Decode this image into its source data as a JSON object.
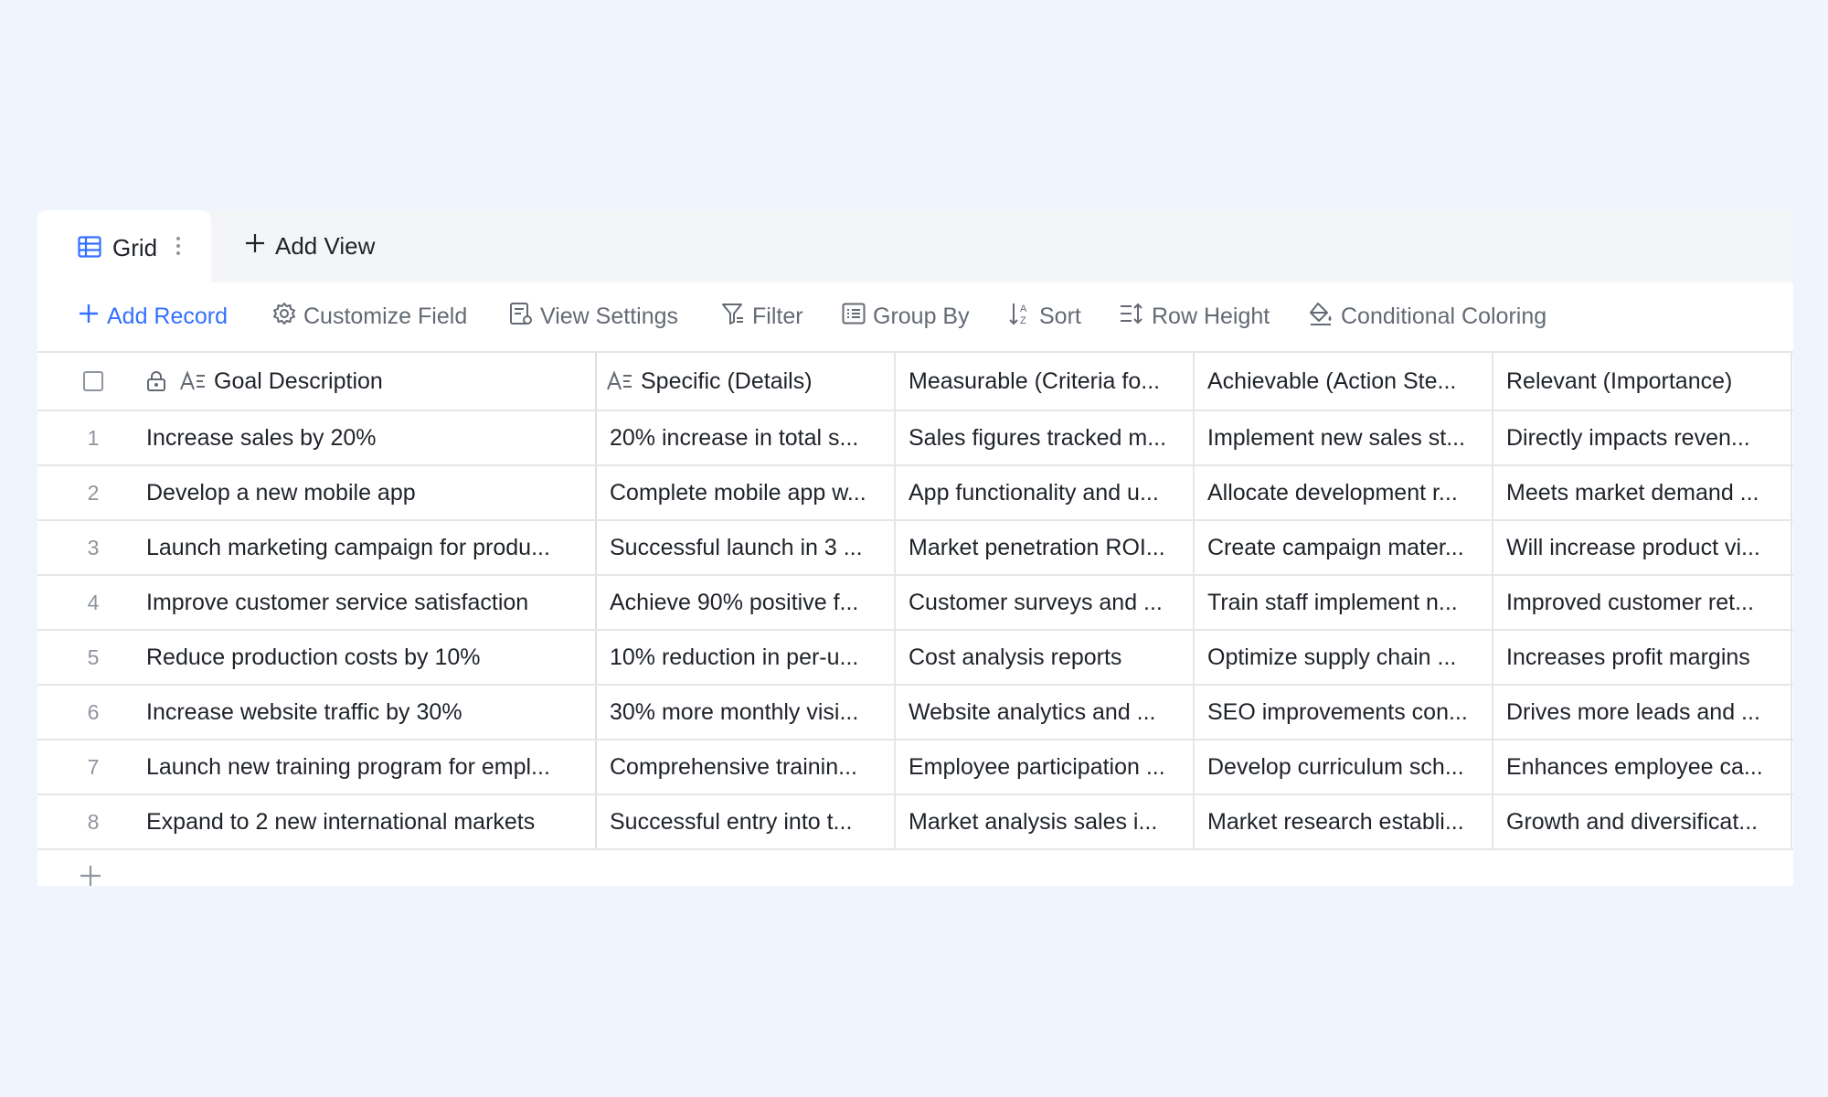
{
  "tabs": {
    "active_label": "Grid",
    "add_view_label": "Add View"
  },
  "toolbar": {
    "add_record": "Add Record",
    "customize_field": "Customize Field",
    "view_settings": "View Settings",
    "filter": "Filter",
    "group_by": "Group By",
    "sort": "Sort",
    "row_height": "Row Height",
    "conditional_coloring": "Conditional Coloring"
  },
  "table": {
    "columns": {
      "goal": "Goal Description",
      "specific": "Specific (Details)",
      "measurable": "Measurable (Criteria fo...",
      "achievable": "Achievable (Action Ste...",
      "relevant": "Relevant (Importance)"
    },
    "rows": [
      {
        "num": "1",
        "goal": "Increase sales by 20%",
        "specific": "20% increase in total s...",
        "measurable": "Sales figures tracked m...",
        "achievable": "Implement new sales st...",
        "relevant": "Directly impacts reven..."
      },
      {
        "num": "2",
        "goal": "Develop a new mobile app",
        "specific": "Complete mobile app w...",
        "measurable": "App functionality and u...",
        "achievable": "Allocate development r...",
        "relevant": "Meets market demand ..."
      },
      {
        "num": "3",
        "goal": "Launch marketing campaign for produ...",
        "specific": "Successful launch in 3 ...",
        "measurable": "Market penetration ROI...",
        "achievable": "Create campaign mater...",
        "relevant": "Will increase product vi..."
      },
      {
        "num": "4",
        "goal": "Improve customer service satisfaction",
        "specific": "Achieve 90% positive f...",
        "measurable": "Customer surveys and ...",
        "achievable": "Train staff implement n...",
        "relevant": "Improved customer ret..."
      },
      {
        "num": "5",
        "goal": "Reduce production costs by 10%",
        "specific": "10% reduction in per-u...",
        "measurable": "Cost analysis reports",
        "achievable": "Optimize supply chain ...",
        "relevant": "Increases profit margins"
      },
      {
        "num": "6",
        "goal": "Increase website traffic by 30%",
        "specific": "30% more monthly visi...",
        "measurable": "Website analytics and ...",
        "achievable": "SEO improvements con...",
        "relevant": "Drives more leads and ..."
      },
      {
        "num": "7",
        "goal": "Launch new training program for empl...",
        "specific": "Comprehensive trainin...",
        "measurable": "Employee participation ...",
        "achievable": "Develop curriculum sch...",
        "relevant": "Enhances employee ca..."
      },
      {
        "num": "8",
        "goal": "Expand to 2 new international markets",
        "specific": "Successful entry into t...",
        "measurable": "Market analysis sales i...",
        "achievable": "Market research establi...",
        "relevant": "Growth and diversificat..."
      }
    ]
  },
  "colors": {
    "accent": "#3370ff",
    "toolbar_text": "#646a73",
    "background": "#f0f4fc"
  },
  "icons": [
    "grid-view-icon",
    "more-vertical-icon",
    "plus-icon",
    "gear-icon",
    "view-settings-icon",
    "filter-icon",
    "group-by-icon",
    "sort-icon",
    "row-height-icon",
    "paint-bucket-icon",
    "lock-icon",
    "text-field-icon"
  ]
}
